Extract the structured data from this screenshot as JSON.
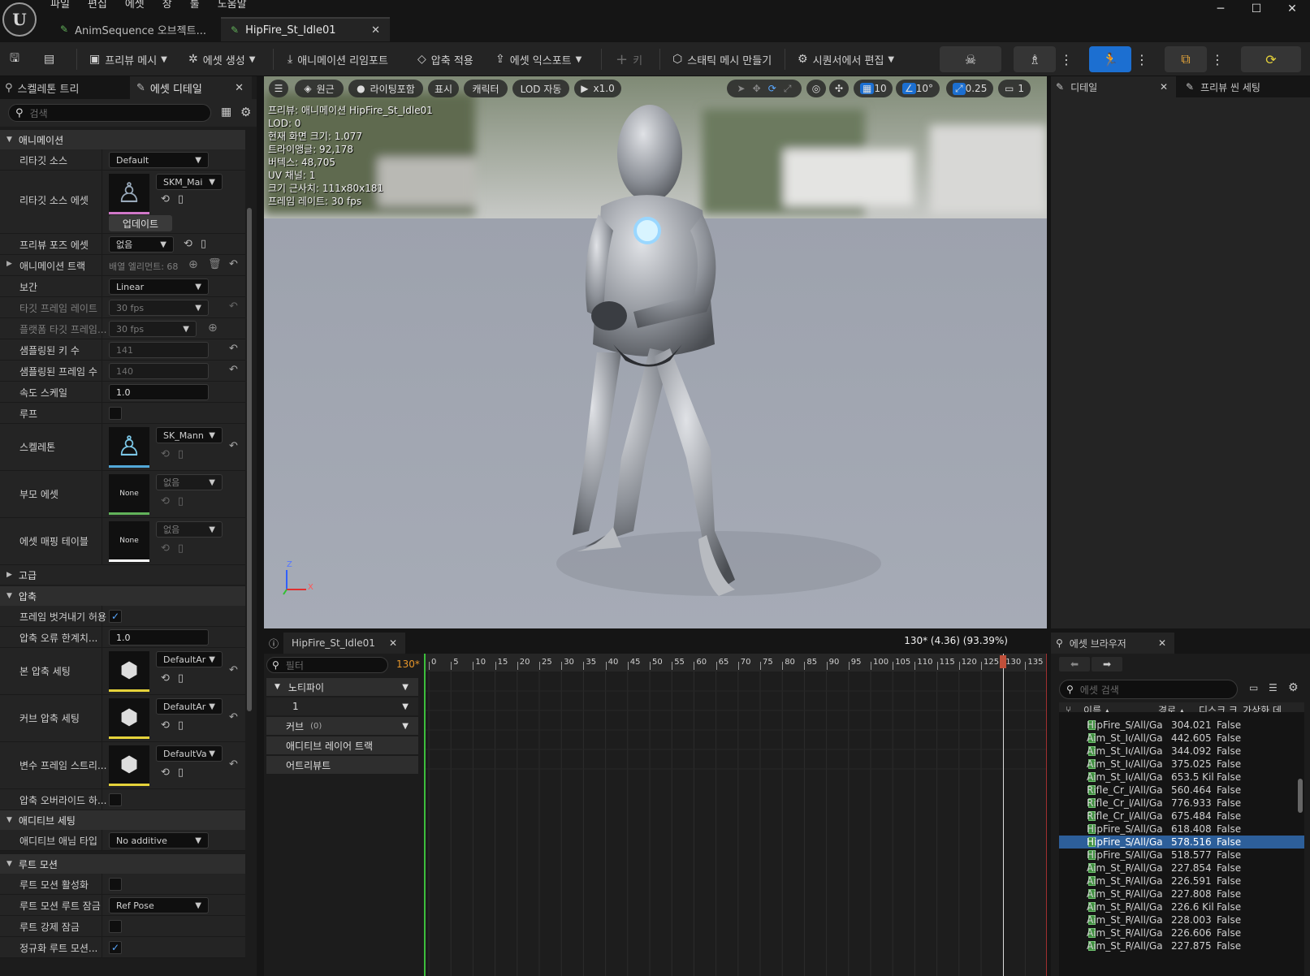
{
  "menu": [
    "파일",
    "편집",
    "에셋",
    "창",
    "툴",
    "도움말"
  ],
  "window_controls": {
    "minimize": "─",
    "maximize": "☐",
    "close": "✕"
  },
  "logo_text": "U",
  "tabs": [
    {
      "label": "AnimSequence 오브젝트..."
    },
    {
      "label": "HipFire_St_Idle01",
      "close": "✕"
    }
  ],
  "toolbar": {
    "preview_mesh": "프리뷰 메시",
    "create_asset": "에셋 생성",
    "reimport": "애니메이션 리임포트",
    "apply_compression": "압축 적용",
    "export_asset": "에셋 익스포트",
    "key": "키",
    "make_static_mesh": "스태틱 메시 만들기",
    "edit_in_sequencer": "시퀀서에서 편집"
  },
  "left_panel": {
    "tab_skeleton_tree": "스켈레톤 트리",
    "tab_asset_details": "에셋 디테일",
    "search_placeholder": "검색",
    "sections": {
      "animation": "애니메이션",
      "advanced": "고급",
      "compression": "압축",
      "additive": "애디티브 세팅",
      "root_motion": "루트 모션"
    },
    "props": {
      "retarget_source": {
        "label": "리타깃 소스",
        "value": "Default"
      },
      "retarget_source_asset": {
        "label": "리타깃 소스 에셋",
        "value": "SKM_Mai",
        "button": "업데이트"
      },
      "preview_pose_asset": {
        "label": "프리뷰 포즈 에셋",
        "value": "없음"
      },
      "anim_track": {
        "label": "애니메이션 트랙",
        "value": "배열 엘리먼트: 68"
      },
      "interpolation": {
        "label": "보간",
        "value": "Linear"
      },
      "target_frame_rate": {
        "label": "타깃 프레임 레이트",
        "value": "30 fps"
      },
      "platform_target_frame": {
        "label": "플랫폼 타깃 프레임...",
        "value": "30 fps"
      },
      "sampled_keys": {
        "label": "샘플링된 키 수",
        "value": "141"
      },
      "sampled_frames": {
        "label": "샘플링된 프레임 수",
        "value": "140"
      },
      "rate_scale": {
        "label": "속도 스케일",
        "value": "1.0"
      },
      "loop": {
        "label": "루프"
      },
      "skeleton": {
        "label": "스켈레톤",
        "value": "SK_Mann"
      },
      "parent_asset": {
        "label": "부모 에셋",
        "value": "없음",
        "thumb": "None"
      },
      "asset_mapping_table": {
        "label": "에셋 매핑 테이블",
        "value": "없음",
        "thumb": "None"
      },
      "allow_frame_strip": {
        "label": "프레임 벗겨내기 허용",
        "check": "✓"
      },
      "compression_error": {
        "label": "압축 오류 한계치...",
        "value": "1.0"
      },
      "bone_compression": {
        "label": "본 압축 세팅",
        "value": "DefaultAr"
      },
      "curve_compression": {
        "label": "커브 압축 세팅",
        "value": "DefaultAr"
      },
      "variable_frame_strip": {
        "label": "변수 프레임 스트리...",
        "value": "DefaultVa"
      },
      "compression_override": {
        "label": "압축 오버라이드 하..."
      },
      "additive_anim_type": {
        "label": "애디티브 애님 타입",
        "value": "No additive"
      },
      "enable_root_motion": {
        "label": "루트 모션 활성화"
      },
      "root_motion_root_lock": {
        "label": "루트 모션 루트 잠금",
        "value": "Ref Pose"
      },
      "force_root_lock": {
        "label": "루트 강제 잠금"
      },
      "normalized_root_motion": {
        "label": "정규화 루트 모션...",
        "check": "✓"
      }
    }
  },
  "viewport": {
    "perspective": "원근",
    "lighting": "라이팅포함",
    "show": "표시",
    "character": "캐릭터",
    "lod": "LOD 자동",
    "play_rate": "x1.0",
    "grid_value": "10",
    "angle_value": "10°",
    "scale_value": "0.25",
    "camera_speed": "1",
    "stats": [
      "프리뷰: 애니메이션 HipFire_St_Idle01",
      "LOD: 0",
      "현재 화면 크기: 1.077",
      "트라이앵글: 92,178",
      "버텍스: 48,705",
      "UV 채널: 1",
      "크기 근사치: 111x80x181",
      "프레임 레이트: 30 fps"
    ],
    "axis_z": "Z",
    "axis_x": "X"
  },
  "right_panel": {
    "tab_details": "디테일",
    "tab_preview_scene": "프리뷰 씬 세팅"
  },
  "timeline": {
    "tab": "HipFire_St_Idle01",
    "filter_placeholder": "필터",
    "frame_badge": "130*",
    "playhead_label": "130* (4.36) (93.39%)",
    "tracks": {
      "notifies": "노티파이",
      "notify_track": "1",
      "curves": "커브",
      "curves_count": "(0)",
      "additive_layer": "애디티브 레이어 트랙",
      "attributes": "어트리뷰트"
    },
    "ticks": [
      "0",
      "5",
      "10",
      "15",
      "20",
      "25",
      "30",
      "35",
      "40",
      "45",
      "50",
      "55",
      "60",
      "65",
      "70",
      "75",
      "80",
      "85",
      "90",
      "95",
      "100",
      "105",
      "110",
      "115",
      "120",
      "125",
      "130",
      "135"
    ]
  },
  "asset_browser": {
    "tab": "에셋 브라우저",
    "search_placeholder": "에셋 검색",
    "columns": {
      "name": "이름",
      "path": "경로",
      "disk": "디스크 크",
      "virtual": "가상화 데"
    },
    "rows": [
      {
        "name": "HipFire_St_I",
        "path": "/All/Ga",
        "size": "304.021",
        "virt": "False"
      },
      {
        "name": "Aim_St_Idle",
        "path": "/All/Ga",
        "size": "442.605",
        "virt": "False"
      },
      {
        "name": "Aim_St_Idle",
        "path": "/All/Ga",
        "size": "344.092",
        "virt": "False"
      },
      {
        "name": "Aim_St_Idle",
        "path": "/All/Ga",
        "size": "375.025",
        "virt": "False"
      },
      {
        "name": "Aim_St_Idle",
        "path": "/All/Ga",
        "size": "653.5 Kil",
        "virt": "False"
      },
      {
        "name": "Rifle_Cr_Idle",
        "path": "/All/Ga",
        "size": "560.464",
        "virt": "False"
      },
      {
        "name": "Rifle_Cr_Idle",
        "path": "/All/Ga",
        "size": "776.933",
        "virt": "False"
      },
      {
        "name": "Rifle_Cr_Idle",
        "path": "/All/Ga",
        "size": "675.484",
        "virt": "False"
      },
      {
        "name": "HipFire_St_I",
        "path": "/All/Ga",
        "size": "618.408",
        "virt": "False"
      },
      {
        "name": "HipFire_St_I",
        "path": "/All/Ga",
        "size": "578.516",
        "virt": "False",
        "selected": true
      },
      {
        "name": "HipFire_St_I",
        "path": "/All/Ga",
        "size": "518.577",
        "virt": "False"
      },
      {
        "name": "Aim_St_Run",
        "path": "/All/Ga",
        "size": "227.854",
        "virt": "False"
      },
      {
        "name": "Aim_St_Run",
        "path": "/All/Ga",
        "size": "226.591",
        "virt": "False"
      },
      {
        "name": "Aim_St_Run",
        "path": "/All/Ga",
        "size": "227.808",
        "virt": "False"
      },
      {
        "name": "Aim_St_Run",
        "path": "/All/Ga",
        "size": "226.6 Kil",
        "virt": "False"
      },
      {
        "name": "Aim_St_Run",
        "path": "/All/Ga",
        "size": "228.003",
        "virt": "False"
      },
      {
        "name": "Aim_St_Run",
        "path": "/All/Ga",
        "size": "226.606",
        "virt": "False"
      },
      {
        "name": "Aim_St_Run",
        "path": "/All/Ga",
        "size": "227.875",
        "virt": "False"
      }
    ]
  },
  "colors": {
    "accent": "#1c6fd1",
    "selection": "#2d5f9a",
    "playhead": "#c0503a",
    "asset_green": "#62b35a"
  }
}
